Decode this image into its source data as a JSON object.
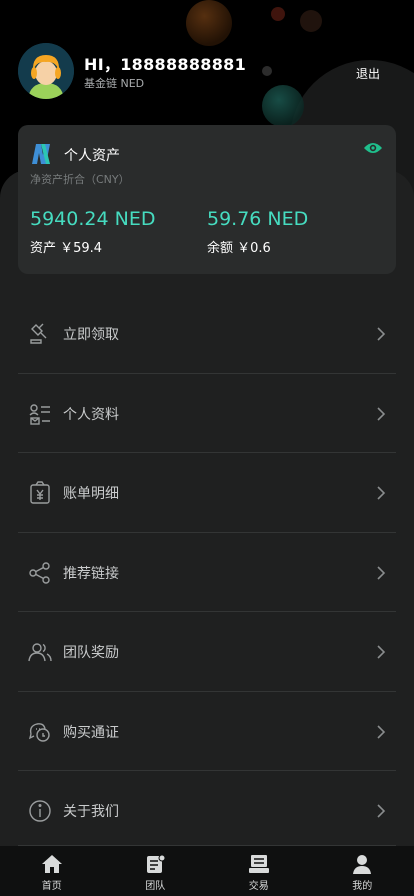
{
  "header": {
    "greeting": "HI，18888888881",
    "chain_label": "基金链 NED",
    "logout_label": "退出"
  },
  "asset_card": {
    "title": "个人资产",
    "subtitle": "净资产折合（CNY）",
    "asset_amount": "5940.24 NED",
    "asset_label": "资产 ￥59.4",
    "balance_amount": "59.76 NED",
    "balance_label": "余额 ￥0.6"
  },
  "menu": {
    "items": [
      {
        "label": "立即领取",
        "icon": "gavel-icon"
      },
      {
        "label": "个人资料",
        "icon": "profile-card-icon"
      },
      {
        "label": "账单明细",
        "icon": "bill-icon"
      },
      {
        "label": "推荐链接",
        "icon": "share-icon"
      },
      {
        "label": "团队奖励",
        "icon": "team-icon"
      },
      {
        "label": "购买通证",
        "icon": "chat-bubbles-icon"
      },
      {
        "label": "关于我们",
        "icon": "info-icon"
      }
    ]
  },
  "tabbar": {
    "tabs": [
      {
        "label": "首页",
        "icon": "home-icon"
      },
      {
        "label": "团队",
        "icon": "team-doc-icon"
      },
      {
        "label": "交易",
        "icon": "trade-icon"
      },
      {
        "label": "我的",
        "icon": "user-icon"
      }
    ]
  },
  "colors": {
    "accent": "#46dcc0",
    "panel": "#1f2020",
    "card": "#2a2c2c",
    "eye": "#1fbf8c"
  }
}
